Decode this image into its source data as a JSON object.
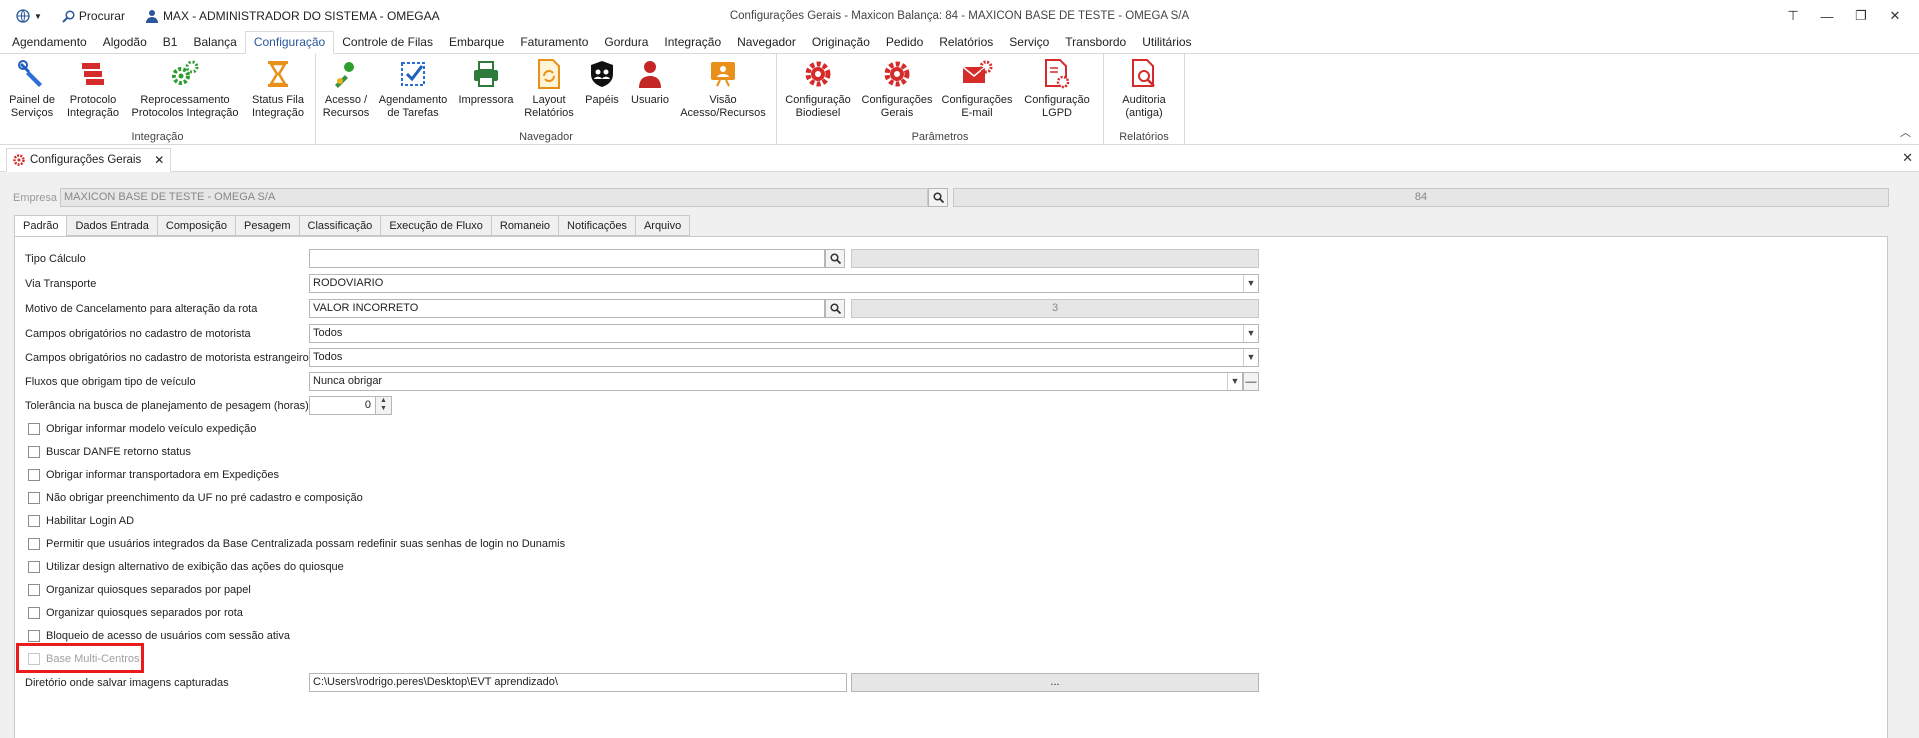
{
  "titlebar": {
    "search_label": "Procurar",
    "user_label": "MAX - ADMINISTRADOR DO SISTEMA - OMEGAA",
    "window_title": "Configurações Gerais - Maxicon Balança: 84 - MAXICON BASE DE TESTE - OMEGA S/A"
  },
  "menu": {
    "tabs": [
      "Agendamento",
      "Algodão",
      "B1",
      "Balança",
      "Configuração",
      "Controle de Filas",
      "Embarque",
      "Faturamento",
      "Gordura",
      "Integração",
      "Navegador",
      "Originação",
      "Pedido",
      "Relatórios",
      "Serviço",
      "Transbordo",
      "Utilitários"
    ],
    "active": "Configuração"
  },
  "ribbon": {
    "groups": {
      "integracao": "Integração",
      "navegador": "Navegador",
      "parametros": "Parâmetros",
      "relatorios": "Relatórios"
    },
    "buttons": {
      "painel_l1": "Painel de",
      "painel_l2": "Serviços",
      "protocolo_l1": "Protocolo",
      "protocolo_l2": "Integração",
      "reproc_l1": "Reprocessamento",
      "reproc_l2": "Protocolos Integração",
      "statusfila_l1": "Status Fila",
      "statusfila_l2": "Integração",
      "acesso_l1": "Acesso /",
      "acesso_l2": "Recursos",
      "agend_l1": "Agendamento",
      "agend_l2": "de Tarefas",
      "impressora_l1": "Impressora",
      "layout_l1": "Layout",
      "layout_l2": "Relatórios",
      "papeis_l1": "Papéis",
      "usuario_l1": "Usuario",
      "visao_l1": "Visão",
      "visao_l2": "Acesso/Recursos",
      "cfgbio_l1": "Configuração",
      "cfgbio_l2": "Biodiesel",
      "cfggerais_l1": "Configurações",
      "cfggerais_l2": "Gerais",
      "cfgemail_l1": "Configurações",
      "cfgemail_l2": "E-mail",
      "cfglgpd_l1": "Configuração",
      "cfglgpd_l2": "LGPD",
      "auditoria_l1": "Auditoria",
      "auditoria_l2": "(antiga)"
    }
  },
  "doc_tab": {
    "label": "Configurações Gerais"
  },
  "empresa": {
    "label": "Empresa",
    "value": "MAXICON BASE DE TESTE - OMEGA S/A",
    "code": "84"
  },
  "inner_tabs": [
    "Padrão",
    "Dados Entrada",
    "Composição",
    "Pesagem",
    "Classificação",
    "Execução de Fluxo",
    "Romaneio",
    "Notificações",
    "Arquivo"
  ],
  "form": {
    "tipo_calculo": {
      "label": "Tipo Cálculo",
      "value": "",
      "code": ""
    },
    "via_transporte": {
      "label": "Via Transporte",
      "value": "RODOVIARIO"
    },
    "motivo_cancelamento": {
      "label": "Motivo de Cancelamento para alteração da rota",
      "value": "VALOR INCORRETO",
      "code": "3"
    },
    "campos_motorista": {
      "label": "Campos obrigatórios no cadastro de motorista",
      "value": "Todos"
    },
    "campos_motorista_estrangeiro": {
      "label": "Campos obrigatórios no cadastro de motorista estrangeiro",
      "value": "Todos"
    },
    "fluxos_veiculo": {
      "label": "Fluxos que obrigam tipo de veículo",
      "value": "Nunca obrigar"
    },
    "tolerancia": {
      "label": "Tolerância na busca de planejamento de pesagem (horas)",
      "value": "0"
    },
    "checkboxes": [
      "Obrigar informar modelo veículo expedição",
      "Buscar DANFE retorno status",
      "Obrigar informar transportadora em Expedições",
      "Não obrigar preenchimento da UF no pré cadastro e composição",
      "Habilitar Login AD",
      "Permitir que usuários integrados da Base Centralizada possam redefinir suas senhas de login no Dunamis",
      "Utilizar design alternativo de exibição das ações do quiosque",
      "Organizar quiosques separados por papel",
      "Organizar quiosques separados por rota",
      "Bloqueio de acesso de usuários com sessão ativa",
      "Base Multi-Centros"
    ],
    "diretorio": {
      "label": "Diretório onde salvar imagens capturadas",
      "value": "C:\\Users\\rodrigo.peres\\Desktop\\EVT aprendizado\\",
      "browse_label": "..."
    }
  },
  "colors": {
    "accent": "#2b579a",
    "highlight": "#e81c1c"
  }
}
